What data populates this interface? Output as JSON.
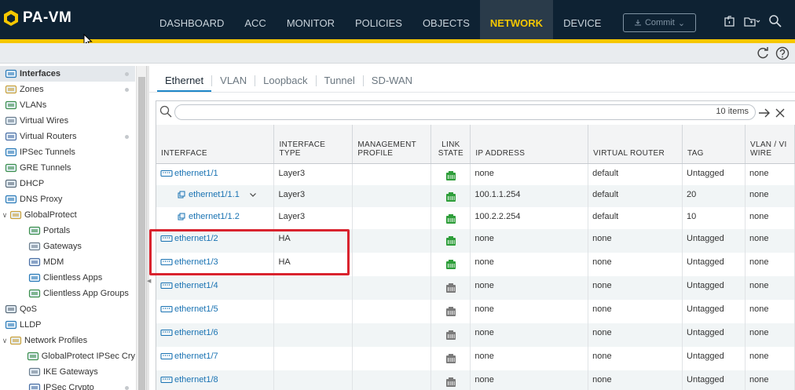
{
  "app": {
    "title": "PA-VM",
    "colors": {
      "accent": "#f6c700",
      "topbar": "#0e2233",
      "link": "#1a73b3",
      "ha_highlight": "#d9232e",
      "link_up": "#2e9e3a",
      "link_down": "#7a7a7a"
    }
  },
  "nav": {
    "items": [
      {
        "label": "DASHBOARD"
      },
      {
        "label": "ACC"
      },
      {
        "label": "MONITOR"
      },
      {
        "label": "POLICIES"
      },
      {
        "label": "OBJECTS"
      },
      {
        "label": "NETWORK",
        "active": true
      },
      {
        "label": "DEVICE"
      }
    ],
    "commit_label": "Commit"
  },
  "sidebar": {
    "items": [
      {
        "label": "Interfaces",
        "icon": "interfaces-icon",
        "active": true,
        "dot": true
      },
      {
        "label": "Zones",
        "icon": "zones-icon",
        "dot": true
      },
      {
        "label": "VLANs",
        "icon": "vlans-icon"
      },
      {
        "label": "Virtual Wires",
        "icon": "virtual-wires-icon"
      },
      {
        "label": "Virtual Routers",
        "icon": "virtual-routers-icon",
        "dot": true
      },
      {
        "label": "IPSec Tunnels",
        "icon": "ipsec-tunnels-icon"
      },
      {
        "label": "GRE Tunnels",
        "icon": "gre-tunnels-icon"
      },
      {
        "label": "DHCP",
        "icon": "dhcp-icon"
      },
      {
        "label": "DNS Proxy",
        "icon": "dns-proxy-icon"
      },
      {
        "label": "GlobalProtect",
        "icon": "globalprotect-icon",
        "expandable": true
      },
      {
        "label": "Portals",
        "icon": "portals-icon",
        "indent": 1
      },
      {
        "label": "Gateways",
        "icon": "gateways-icon",
        "indent": 1
      },
      {
        "label": "MDM",
        "icon": "mdm-icon",
        "indent": 1
      },
      {
        "label": "Clientless Apps",
        "icon": "clientless-apps-icon",
        "indent": 1
      },
      {
        "label": "Clientless App Groups",
        "icon": "clientless-app-groups-icon",
        "indent": 1
      },
      {
        "label": "QoS",
        "icon": "qos-icon"
      },
      {
        "label": "LLDP",
        "icon": "lldp-icon"
      },
      {
        "label": "Network Profiles",
        "icon": "network-profiles-icon",
        "expandable": true
      },
      {
        "label": "GlobalProtect IPSec Cry",
        "icon": "gp-ipsec-crypto-icon",
        "indent": 1
      },
      {
        "label": "IKE Gateways",
        "icon": "ike-gateways-icon",
        "indent": 1
      },
      {
        "label": "IPSec Crypto",
        "icon": "ipsec-crypto-icon",
        "indent": 1,
        "dot": true
      }
    ]
  },
  "tabs": [
    {
      "label": "Ethernet",
      "active": true
    },
    {
      "label": "VLAN"
    },
    {
      "label": "Loopback"
    },
    {
      "label": "Tunnel"
    },
    {
      "label": "SD-WAN"
    }
  ],
  "filter": {
    "placeholder": "",
    "count_text": "10 items"
  },
  "table": {
    "columns": [
      {
        "label": "INTERFACE"
      },
      {
        "label": "INTERFACE TYPE"
      },
      {
        "label": "MANAGEMENT PROFILE"
      },
      {
        "label": "LINK STATE"
      },
      {
        "label": "IP ADDRESS"
      },
      {
        "label": "VIRTUAL ROUTER"
      },
      {
        "label": "TAG"
      },
      {
        "label": "VLAN / VI WIRE"
      }
    ],
    "rows": [
      {
        "interface": "ethernet1/1",
        "type": "Layer3",
        "mgmt": "",
        "link": "up",
        "ip": "none",
        "vr": "default",
        "tag": "Untagged",
        "vlan": "none"
      },
      {
        "interface": "ethernet1/1.1",
        "sub": true,
        "expanded": true,
        "type": "Layer3",
        "mgmt": "",
        "link": "up",
        "ip": "100.1.1.254",
        "vr": "default",
        "tag": "20",
        "vlan": "none"
      },
      {
        "interface": "ethernet1/1.2",
        "sub": true,
        "type": "Layer3",
        "mgmt": "",
        "link": "up",
        "ip": "100.2.2.254",
        "vr": "default",
        "tag": "10",
        "vlan": "none"
      },
      {
        "interface": "ethernet1/2",
        "type": "HA",
        "mgmt": "",
        "link": "up",
        "ip": "none",
        "vr": "none",
        "tag": "Untagged",
        "vlan": "none"
      },
      {
        "interface": "ethernet1/3",
        "type": "HA",
        "mgmt": "",
        "link": "up",
        "ip": "none",
        "vr": "none",
        "tag": "Untagged",
        "vlan": "none"
      },
      {
        "interface": "ethernet1/4",
        "type": "",
        "mgmt": "",
        "link": "down",
        "ip": "none",
        "vr": "none",
        "tag": "Untagged",
        "vlan": "none"
      },
      {
        "interface": "ethernet1/5",
        "type": "",
        "mgmt": "",
        "link": "down",
        "ip": "none",
        "vr": "none",
        "tag": "Untagged",
        "vlan": "none"
      },
      {
        "interface": "ethernet1/6",
        "type": "",
        "mgmt": "",
        "link": "down",
        "ip": "none",
        "vr": "none",
        "tag": "Untagged",
        "vlan": "none"
      },
      {
        "interface": "ethernet1/7",
        "type": "",
        "mgmt": "",
        "link": "down",
        "ip": "none",
        "vr": "none",
        "tag": "Untagged",
        "vlan": "none"
      },
      {
        "interface": "ethernet1/8",
        "type": "",
        "mgmt": "",
        "link": "down",
        "ip": "none",
        "vr": "none",
        "tag": "Untagged",
        "vlan": "none"
      }
    ]
  }
}
